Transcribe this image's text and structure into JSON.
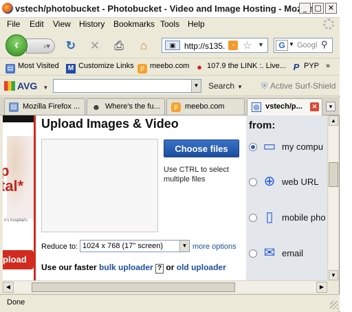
{
  "window": {
    "title": "vstech/photobucket - Photobucket - Video and Image Hosting - Mozilla",
    "minimize": "_",
    "maximize": "□",
    "close": "✕"
  },
  "menu": {
    "items": [
      "File",
      "Edit",
      "View",
      "History",
      "Bookmarks",
      "Tools",
      "Help"
    ]
  },
  "navigation": {
    "url": "http://s135.",
    "search_placeholder": "Googl",
    "search_engine": "G"
  },
  "bookmarks": {
    "items": [
      {
        "label": "Most Visited",
        "icon": "most-visited-icon"
      },
      {
        "label": "Customize Links",
        "icon": "customize-links-icon"
      },
      {
        "label": "meebo.com",
        "icon": "meebo-icon"
      },
      {
        "label": "107.9 the LINK :. Live...",
        "icon": "speech-bubble-icon"
      },
      {
        "label": "PYP",
        "icon": "pyp-icon"
      }
    ],
    "overflow": "»"
  },
  "avg_toolbar": {
    "logo": "AVG",
    "search_label": "Search",
    "shield_label": "Active Surf-Shield"
  },
  "tabs": [
    {
      "label": "Mozilla Firefox ...",
      "active": false
    },
    {
      "label": "Where's the fu...",
      "active": false
    },
    {
      "label": "meebo.com",
      "active": false
    },
    {
      "label": "vstech/p...",
      "active": true
    }
  ],
  "page": {
    "left_strip": {
      "char_p": "p",
      "char_tal": "tal*",
      "small_text": "n's hospital's",
      "button": "pload"
    },
    "upload": {
      "title": "Upload Images & Video",
      "choose_button": "Choose files",
      "hint": "Use CTRL to select multiple files",
      "reduce_label": "Reduce to:",
      "reduce_value": "1024 x 768 (17\" screen)",
      "more_options": "more options",
      "faster_prefix": "Use our faster",
      "bulk_uploader": "bulk uploader",
      "qmark": "?",
      "or_text": "or",
      "old_uploader": "old uploader"
    },
    "from": {
      "title": "from:",
      "options": [
        {
          "label": "my compu",
          "icon": "computer-icon",
          "selected": true
        },
        {
          "label": "web URL",
          "icon": "globe-icon",
          "selected": false
        },
        {
          "label": "mobile pho",
          "icon": "mobile-phone-icon",
          "selected": false
        },
        {
          "label": "email",
          "icon": "envelope-icon",
          "selected": false
        }
      ]
    }
  },
  "status": {
    "text": "Done"
  }
}
